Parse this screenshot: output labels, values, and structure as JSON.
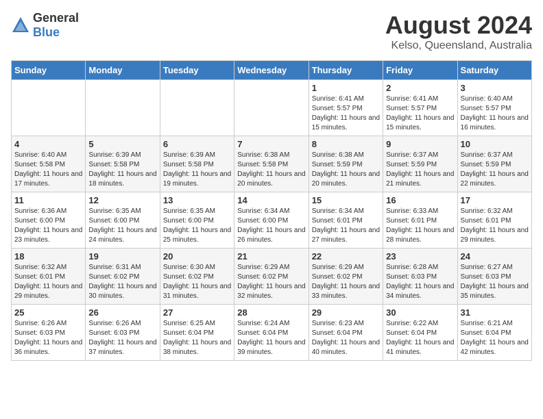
{
  "logo": {
    "general": "General",
    "blue": "Blue"
  },
  "title": "August 2024",
  "subtitle": "Kelso, Queensland, Australia",
  "days_of_week": [
    "Sunday",
    "Monday",
    "Tuesday",
    "Wednesday",
    "Thursday",
    "Friday",
    "Saturday"
  ],
  "weeks": [
    [
      {
        "day": "",
        "info": ""
      },
      {
        "day": "",
        "info": ""
      },
      {
        "day": "",
        "info": ""
      },
      {
        "day": "",
        "info": ""
      },
      {
        "day": "1",
        "info": "Sunrise: 6:41 AM\nSunset: 5:57 PM\nDaylight: 11 hours and 15 minutes."
      },
      {
        "day": "2",
        "info": "Sunrise: 6:41 AM\nSunset: 5:57 PM\nDaylight: 11 hours and 15 minutes."
      },
      {
        "day": "3",
        "info": "Sunrise: 6:40 AM\nSunset: 5:57 PM\nDaylight: 11 hours and 16 minutes."
      }
    ],
    [
      {
        "day": "4",
        "info": "Sunrise: 6:40 AM\nSunset: 5:58 PM\nDaylight: 11 hours and 17 minutes."
      },
      {
        "day": "5",
        "info": "Sunrise: 6:39 AM\nSunset: 5:58 PM\nDaylight: 11 hours and 18 minutes."
      },
      {
        "day": "6",
        "info": "Sunrise: 6:39 AM\nSunset: 5:58 PM\nDaylight: 11 hours and 19 minutes."
      },
      {
        "day": "7",
        "info": "Sunrise: 6:38 AM\nSunset: 5:58 PM\nDaylight: 11 hours and 20 minutes."
      },
      {
        "day": "8",
        "info": "Sunrise: 6:38 AM\nSunset: 5:59 PM\nDaylight: 11 hours and 20 minutes."
      },
      {
        "day": "9",
        "info": "Sunrise: 6:37 AM\nSunset: 5:59 PM\nDaylight: 11 hours and 21 minutes."
      },
      {
        "day": "10",
        "info": "Sunrise: 6:37 AM\nSunset: 5:59 PM\nDaylight: 11 hours and 22 minutes."
      }
    ],
    [
      {
        "day": "11",
        "info": "Sunrise: 6:36 AM\nSunset: 6:00 PM\nDaylight: 11 hours and 23 minutes."
      },
      {
        "day": "12",
        "info": "Sunrise: 6:35 AM\nSunset: 6:00 PM\nDaylight: 11 hours and 24 minutes."
      },
      {
        "day": "13",
        "info": "Sunrise: 6:35 AM\nSunset: 6:00 PM\nDaylight: 11 hours and 25 minutes."
      },
      {
        "day": "14",
        "info": "Sunrise: 6:34 AM\nSunset: 6:00 PM\nDaylight: 11 hours and 26 minutes."
      },
      {
        "day": "15",
        "info": "Sunrise: 6:34 AM\nSunset: 6:01 PM\nDaylight: 11 hours and 27 minutes."
      },
      {
        "day": "16",
        "info": "Sunrise: 6:33 AM\nSunset: 6:01 PM\nDaylight: 11 hours and 28 minutes."
      },
      {
        "day": "17",
        "info": "Sunrise: 6:32 AM\nSunset: 6:01 PM\nDaylight: 11 hours and 29 minutes."
      }
    ],
    [
      {
        "day": "18",
        "info": "Sunrise: 6:32 AM\nSunset: 6:01 PM\nDaylight: 11 hours and 29 minutes."
      },
      {
        "day": "19",
        "info": "Sunrise: 6:31 AM\nSunset: 6:02 PM\nDaylight: 11 hours and 30 minutes."
      },
      {
        "day": "20",
        "info": "Sunrise: 6:30 AM\nSunset: 6:02 PM\nDaylight: 11 hours and 31 minutes."
      },
      {
        "day": "21",
        "info": "Sunrise: 6:29 AM\nSunset: 6:02 PM\nDaylight: 11 hours and 32 minutes."
      },
      {
        "day": "22",
        "info": "Sunrise: 6:29 AM\nSunset: 6:02 PM\nDaylight: 11 hours and 33 minutes."
      },
      {
        "day": "23",
        "info": "Sunrise: 6:28 AM\nSunset: 6:03 PM\nDaylight: 11 hours and 34 minutes."
      },
      {
        "day": "24",
        "info": "Sunrise: 6:27 AM\nSunset: 6:03 PM\nDaylight: 11 hours and 35 minutes."
      }
    ],
    [
      {
        "day": "25",
        "info": "Sunrise: 6:26 AM\nSunset: 6:03 PM\nDaylight: 11 hours and 36 minutes."
      },
      {
        "day": "26",
        "info": "Sunrise: 6:26 AM\nSunset: 6:03 PM\nDaylight: 11 hours and 37 minutes."
      },
      {
        "day": "27",
        "info": "Sunrise: 6:25 AM\nSunset: 6:04 PM\nDaylight: 11 hours and 38 minutes."
      },
      {
        "day": "28",
        "info": "Sunrise: 6:24 AM\nSunset: 6:04 PM\nDaylight: 11 hours and 39 minutes."
      },
      {
        "day": "29",
        "info": "Sunrise: 6:23 AM\nSunset: 6:04 PM\nDaylight: 11 hours and 40 minutes."
      },
      {
        "day": "30",
        "info": "Sunrise: 6:22 AM\nSunset: 6:04 PM\nDaylight: 11 hours and 41 minutes."
      },
      {
        "day": "31",
        "info": "Sunrise: 6:21 AM\nSunset: 6:04 PM\nDaylight: 11 hours and 42 minutes."
      }
    ]
  ]
}
